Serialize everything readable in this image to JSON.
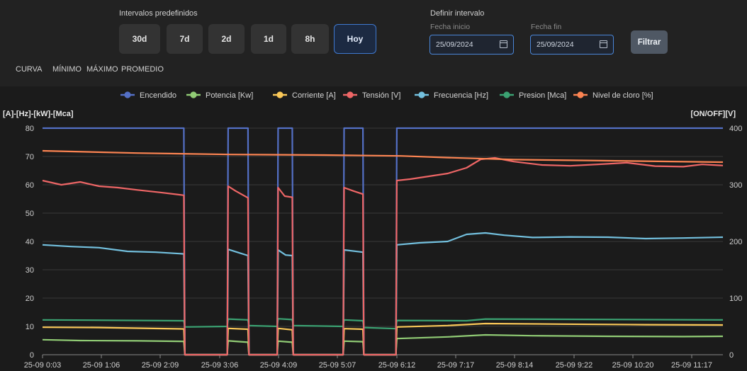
{
  "toolbar": {
    "presets_title": "Intervalos predefinidos",
    "presets": [
      "30d",
      "7d",
      "2d",
      "1d",
      "8h",
      "Hoy"
    ],
    "active_preset": "Hoy",
    "range_title": "Definir intervalo",
    "start_label": "Fecha inicio",
    "start_value": "25/09/2024",
    "end_label": "Fecha fin",
    "end_value": "25/09/2024",
    "filter_label": "Filtrar"
  },
  "tabs": [
    "CURVA",
    "MÍNIMO",
    "MÁXIMO",
    "PROMEDIO"
  ],
  "colors": {
    "Encendido": "#5470c6",
    "Potencia": "#91cc75",
    "Corriente": "#fac858",
    "Tension": "#ee6666",
    "Frecuencia": "#73c0de",
    "Presion": "#3ba272",
    "Cloro": "#fc8452"
  },
  "chart_data": {
    "type": "line",
    "y_left_label": "[A]-[Hz]-[kW]-[Mca]",
    "y_right_label": "[ON/OFF][V]",
    "y_left_ticks": [
      0,
      10,
      20,
      30,
      40,
      50,
      60,
      70,
      80
    ],
    "y_right_ticks": [
      0,
      100,
      200,
      300,
      400
    ],
    "ylim_left": [
      0,
      80
    ],
    "ylim_right": [
      0,
      400
    ],
    "x_ticks": [
      "25-09 0:03",
      "25-09 1:06",
      "25-09 2:09",
      "25-09 3:06",
      "25-09 4:09",
      "25-09 5:07",
      "25-09 6:12",
      "25-09 7:17",
      "25-09 8:14",
      "25-09 9:22",
      "25-09 10:20",
      "25-09 11:17"
    ],
    "legend_position": "top",
    "grid": true,
    "on_intervals_min": [
      [
        0,
        150
      ],
      [
        197,
        218
      ],
      [
        250,
        265
      ],
      [
        320,
        340
      ],
      [
        376,
        722
      ]
    ],
    "series": [
      {
        "name": "Encendido",
        "axis": "right",
        "points": [
          [
            0,
            400
          ],
          [
            150,
            400
          ],
          [
            151,
            0
          ],
          [
            196,
            0
          ],
          [
            197,
            400
          ],
          [
            218,
            400
          ],
          [
            219,
            0
          ],
          [
            249,
            0
          ],
          [
            250,
            400
          ],
          [
            265,
            400
          ],
          [
            266,
            0
          ],
          [
            319,
            0
          ],
          [
            320,
            400
          ],
          [
            340,
            400
          ],
          [
            341,
            0
          ],
          [
            375,
            0
          ],
          [
            376,
            400
          ],
          [
            722,
            400
          ]
        ]
      },
      {
        "name": "Potencia [Kw]",
        "axis": "left",
        "points": [
          [
            0,
            5.3
          ],
          [
            40,
            5.0
          ],
          [
            100,
            4.9
          ],
          [
            150,
            4.7
          ],
          [
            151,
            0
          ],
          [
            196,
            0
          ],
          [
            197,
            4.9
          ],
          [
            218,
            4.4
          ],
          [
            219,
            0
          ],
          [
            249,
            0
          ],
          [
            250,
            4.8
          ],
          [
            265,
            4.4
          ],
          [
            266,
            0
          ],
          [
            319,
            0
          ],
          [
            320,
            4.8
          ],
          [
            340,
            4.6
          ],
          [
            341,
            0
          ],
          [
            375,
            0
          ],
          [
            376,
            5.7
          ],
          [
            430,
            6.3
          ],
          [
            470,
            7.0
          ],
          [
            520,
            6.7
          ],
          [
            600,
            6.5
          ],
          [
            680,
            6.4
          ],
          [
            722,
            6.5
          ]
        ]
      },
      {
        "name": "Corriente [A]",
        "axis": "left",
        "points": [
          [
            0,
            9.7
          ],
          [
            60,
            9.6
          ],
          [
            150,
            9.1
          ],
          [
            151,
            0
          ],
          [
            196,
            0
          ],
          [
            197,
            9.3
          ],
          [
            218,
            9.0
          ],
          [
            219,
            0
          ],
          [
            249,
            0
          ],
          [
            250,
            9.3
          ],
          [
            265,
            8.8
          ],
          [
            266,
            0
          ],
          [
            319,
            0
          ],
          [
            320,
            9.2
          ],
          [
            340,
            9.0
          ],
          [
            341,
            0
          ],
          [
            375,
            0
          ],
          [
            376,
            9.8
          ],
          [
            430,
            10.3
          ],
          [
            470,
            11.0
          ],
          [
            550,
            10.8
          ],
          [
            640,
            10.6
          ],
          [
            722,
            10.5
          ]
        ]
      },
      {
        "name": "Tensión [V]",
        "axis": "left",
        "points": [
          [
            0,
            61.5
          ],
          [
            20,
            60.0
          ],
          [
            40,
            61.0
          ],
          [
            60,
            59.5
          ],
          [
            80,
            59.0
          ],
          [
            100,
            58.2
          ],
          [
            125,
            57.3
          ],
          [
            150,
            56.3
          ],
          [
            151,
            0
          ],
          [
            196,
            0
          ],
          [
            197,
            59.5
          ],
          [
            205,
            57.8
          ],
          [
            218,
            55.4
          ],
          [
            219,
            0
          ],
          [
            249,
            0
          ],
          [
            250,
            59.0
          ],
          [
            257,
            56.0
          ],
          [
            265,
            55.6
          ],
          [
            266,
            0
          ],
          [
            319,
            0
          ],
          [
            320,
            59.0
          ],
          [
            330,
            57.8
          ],
          [
            340,
            56.7
          ],
          [
            341,
            0
          ],
          [
            375,
            0
          ],
          [
            376,
            61.5
          ],
          [
            390,
            62.0
          ],
          [
            410,
            63.0
          ],
          [
            430,
            64.0
          ],
          [
            450,
            66.0
          ],
          [
            465,
            69.0
          ],
          [
            480,
            69.5
          ],
          [
            500,
            68.2
          ],
          [
            530,
            67.0
          ],
          [
            560,
            66.7
          ],
          [
            600,
            67.4
          ],
          [
            620,
            67.8
          ],
          [
            650,
            66.6
          ],
          [
            680,
            66.4
          ],
          [
            700,
            67.2
          ],
          [
            722,
            66.8
          ]
        ]
      },
      {
        "name": "Frecuencia [Hz]",
        "axis": "left",
        "points": [
          [
            0,
            38.8
          ],
          [
            30,
            38.2
          ],
          [
            60,
            37.8
          ],
          [
            90,
            36.5
          ],
          [
            120,
            36.2
          ],
          [
            150,
            35.6
          ],
          [
            151,
            0
          ],
          [
            196,
            0
          ],
          [
            197,
            37.2
          ],
          [
            218,
            35.0
          ],
          [
            219,
            0
          ],
          [
            249,
            0
          ],
          [
            250,
            37.0
          ],
          [
            258,
            35.2
          ],
          [
            265,
            35.0
          ],
          [
            266,
            0
          ],
          [
            319,
            0
          ],
          [
            320,
            37.0
          ],
          [
            340,
            36.2
          ],
          [
            341,
            0
          ],
          [
            375,
            0
          ],
          [
            376,
            38.8
          ],
          [
            400,
            39.5
          ],
          [
            430,
            40.0
          ],
          [
            450,
            42.5
          ],
          [
            470,
            43.0
          ],
          [
            490,
            42.2
          ],
          [
            520,
            41.4
          ],
          [
            560,
            41.6
          ],
          [
            600,
            41.5
          ],
          [
            640,
            41.0
          ],
          [
            680,
            41.2
          ],
          [
            722,
            41.5
          ]
        ]
      },
      {
        "name": "Presion [Mca]",
        "axis": "left",
        "points": [
          [
            0,
            12.3
          ],
          [
            150,
            12.0
          ],
          [
            151,
            9.8
          ],
          [
            196,
            10.0
          ],
          [
            197,
            12.6
          ],
          [
            218,
            12.3
          ],
          [
            219,
            10.3
          ],
          [
            249,
            10.0
          ],
          [
            250,
            12.7
          ],
          [
            265,
            12.4
          ],
          [
            266,
            10.3
          ],
          [
            319,
            10.0
          ],
          [
            320,
            12.3
          ],
          [
            340,
            12.0
          ],
          [
            341,
            9.6
          ],
          [
            375,
            9.2
          ],
          [
            376,
            12.1
          ],
          [
            450,
            12.0
          ],
          [
            470,
            12.6
          ],
          [
            722,
            12.3
          ]
        ]
      },
      {
        "name": "Nivel de cloro [%]",
        "axis": "left",
        "points": [
          [
            0,
            72.0
          ],
          [
            100,
            71.2
          ],
          [
            200,
            70.7
          ],
          [
            300,
            70.5
          ],
          [
            380,
            70.2
          ],
          [
            430,
            69.6
          ],
          [
            500,
            68.9
          ],
          [
            600,
            68.5
          ],
          [
            722,
            68.0
          ]
        ]
      }
    ]
  },
  "legend": [
    "Encendido",
    "Potencia [Kw]",
    "Corriente [A]",
    "Tensión [V]",
    "Frecuencia [Hz]",
    "Presion [Mca]",
    "Nivel de cloro [%]"
  ]
}
